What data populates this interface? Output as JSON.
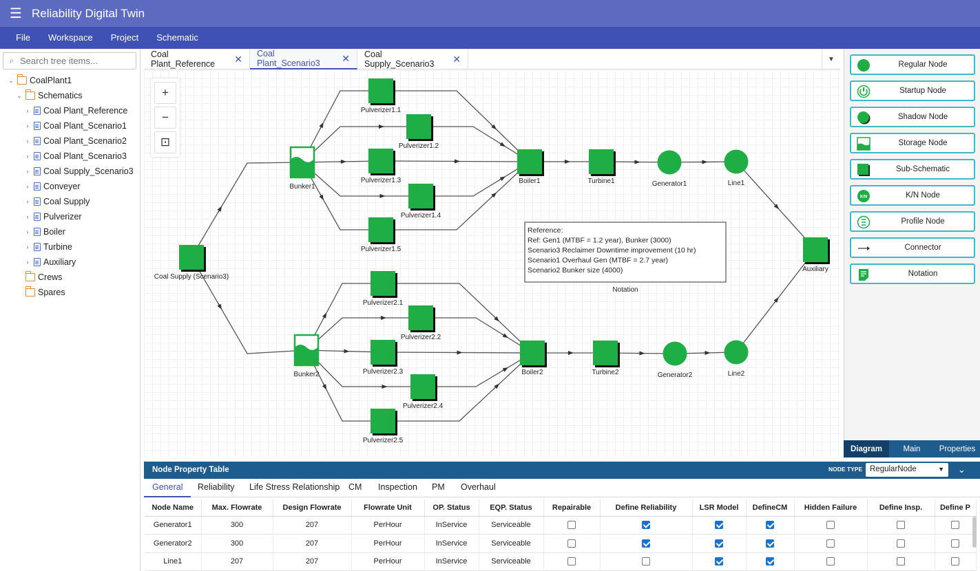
{
  "app": {
    "title": "Reliability Digital Twin"
  },
  "menu": [
    "File",
    "Workspace",
    "Project",
    "Schematic"
  ],
  "sidebar": {
    "search_placeholder": "Search tree items...",
    "tree": [
      {
        "label": "CoalPlant1",
        "level": 0,
        "type": "folder",
        "expanded": true
      },
      {
        "label": "Schematics",
        "level": 1,
        "type": "folder",
        "expanded": true
      },
      {
        "label": "Coal Plant_Reference",
        "level": 2,
        "type": "doc"
      },
      {
        "label": "Coal Plant_Scenario1",
        "level": 2,
        "type": "doc"
      },
      {
        "label": "Coal Plant_Scenario2",
        "level": 2,
        "type": "doc"
      },
      {
        "label": "Coal Plant_Scenario3",
        "level": 2,
        "type": "doc"
      },
      {
        "label": "Coal Supply_Scenario3",
        "level": 2,
        "type": "doc"
      },
      {
        "label": "Conveyer",
        "level": 2,
        "type": "doc"
      },
      {
        "label": "Coal Supply",
        "level": 2,
        "type": "doc"
      },
      {
        "label": "Pulverizer",
        "level": 2,
        "type": "doc"
      },
      {
        "label": "Boiler",
        "level": 2,
        "type": "doc"
      },
      {
        "label": "Turbine",
        "level": 2,
        "type": "doc"
      },
      {
        "label": "Auxiliary",
        "level": 2,
        "type": "doc"
      },
      {
        "label": "Crews",
        "level": 1,
        "type": "folder-leaf"
      },
      {
        "label": "Spares",
        "level": 1,
        "type": "folder-leaf"
      }
    ]
  },
  "tabs": [
    {
      "label": "Coal Plant_Reference",
      "active": false
    },
    {
      "label": "Coal Plant_Scenario3",
      "active": true
    },
    {
      "label": "Coal Supply_Scenario3",
      "active": false
    }
  ],
  "zoom": {
    "in": "+",
    "out": "−",
    "fit": "⊡"
  },
  "diagram": {
    "nodes": [
      {
        "label": "Coal Supply (Scenario3)",
        "kind": "sub"
      },
      {
        "label": "Bunker1",
        "kind": "storage"
      },
      {
        "label": "Pulverizer1.1",
        "kind": "sub"
      },
      {
        "label": "Pulverizer1.2",
        "kind": "sub"
      },
      {
        "label": "Pulverizer1.3",
        "kind": "sub"
      },
      {
        "label": "Pulverizer1.4",
        "kind": "sub"
      },
      {
        "label": "Pulverizer1.5",
        "kind": "sub"
      },
      {
        "label": "Boiler1",
        "kind": "sub"
      },
      {
        "label": "Turbine1",
        "kind": "sub"
      },
      {
        "label": "Generator1",
        "kind": "regular"
      },
      {
        "label": "Line1",
        "kind": "regular"
      },
      {
        "label": "Auxiliary",
        "kind": "sub"
      },
      {
        "label": "Bunker2",
        "kind": "storage"
      },
      {
        "label": "Pulverizer2.1",
        "kind": "sub"
      },
      {
        "label": "Pulverizer2.2",
        "kind": "sub"
      },
      {
        "label": "Pulverizer2.3",
        "kind": "sub"
      },
      {
        "label": "Pulverizer2.4",
        "kind": "sub"
      },
      {
        "label": "Pulverizer2.5",
        "kind": "sub"
      },
      {
        "label": "Boiler2",
        "kind": "sub"
      },
      {
        "label": "Turbine2",
        "kind": "sub"
      },
      {
        "label": "Generator2",
        "kind": "regular"
      },
      {
        "label": "Line2",
        "kind": "regular"
      }
    ],
    "notation": {
      "lines": [
        "Reference:",
        "Ref: Gen1 (MTBF = 1.2 year), Bunker (3000)",
        "Scenario3 Reclaimer Downtime improvement (10 hr)",
        "Scenario1 Overhaul Gen (MTBF = 2.7 year)",
        "Scenario2 Bunker size (4000)"
      ],
      "caption": "Notation"
    }
  },
  "palette": [
    {
      "label": "Regular Node",
      "icon": "regular-node-icon"
    },
    {
      "label": "Startup Node",
      "icon": "startup-node-icon"
    },
    {
      "label": "Shadow Node",
      "icon": "shadow-node-icon"
    },
    {
      "label": "Storage Node",
      "icon": "storage-node-icon"
    },
    {
      "label": "Sub-Schematic",
      "icon": "sub-schematic-icon"
    },
    {
      "label": "K/N Node",
      "icon": "kn-node-icon",
      "badge": "K/N"
    },
    {
      "label": "Profile Node",
      "icon": "profile-node-icon"
    },
    {
      "label": "Connector",
      "icon": "connector-icon"
    },
    {
      "label": "Notation",
      "icon": "notation-icon"
    }
  ],
  "right_tabs": [
    {
      "label": "Diagram",
      "active": true
    },
    {
      "label": "Main",
      "active": false
    },
    {
      "label": "Properties",
      "active": false
    }
  ],
  "bottom": {
    "title": "Node Property Table",
    "node_type_label": "NODE TYPE",
    "node_type_value": "RegularNode",
    "tabs": [
      "General",
      "Reliability",
      "Life Stress Relationship",
      "CM",
      "Inspection",
      "PM",
      "Overhaul"
    ],
    "active_tab": "General",
    "columns": [
      "Node Name",
      "Max. Flowrate",
      "Design Flowrate",
      "Flowrate Unit",
      "OP. Status",
      "EQP. Status",
      "Repairable",
      "Define Reliability",
      "LSR Model",
      "DefineCM",
      "Hidden Failure",
      "Define Insp.",
      "Define P"
    ],
    "rows": [
      [
        "Generator1",
        "300",
        "207",
        "PerHour",
        "InService",
        "Serviceable",
        false,
        true,
        true,
        true,
        false,
        false,
        false
      ],
      [
        "Generator2",
        "300",
        "207",
        "PerHour",
        "InService",
        "Serviceable",
        false,
        true,
        true,
        true,
        false,
        false,
        false
      ],
      [
        "Line1",
        "207",
        "207",
        "PerHour",
        "InService",
        "Serviceable",
        false,
        false,
        true,
        true,
        false,
        false,
        false
      ]
    ]
  },
  "colors": {
    "titlebar": "#5c6bc0",
    "menubar": "#3f51b5",
    "node_green": "#1fae45",
    "panel_blue": "#1f5c8e",
    "palette_border": "#3fb9c8"
  }
}
